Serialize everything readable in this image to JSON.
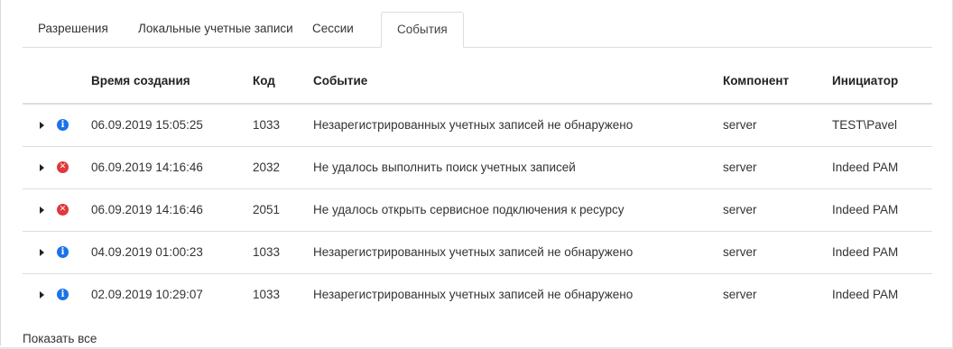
{
  "tabs": [
    {
      "label": "Разрешения",
      "active": false
    },
    {
      "label": "Локальные учетные записи",
      "active": false
    },
    {
      "label": "Сессии",
      "active": false
    },
    {
      "label": "События",
      "active": true
    }
  ],
  "table": {
    "headers": {
      "time": "Время создания",
      "code": "Код",
      "event": "Событие",
      "component": "Компонент",
      "initiator": "Инициатор"
    },
    "rows": [
      {
        "status": "info-icon",
        "time": "06.09.2019 15:05:25",
        "code": "1033",
        "event": "Незарегистрированных учетных записей не обнаружено",
        "component": "server",
        "initiator": "TEST\\Pavel"
      },
      {
        "status": "error-icon",
        "time": "06.09.2019 14:16:46",
        "code": "2032",
        "event": "Не удалось выполнить поиск учетных записей",
        "component": "server",
        "initiator": "Indeed PAM"
      },
      {
        "status": "error-icon",
        "time": "06.09.2019 14:16:46",
        "code": "2051",
        "event": "Не удалось открыть сервисное подключения к ресурсу",
        "component": "server",
        "initiator": "Indeed PAM"
      },
      {
        "status": "info-icon",
        "time": "04.09.2019 01:00:23",
        "code": "1033",
        "event": "Незарегистрированных учетных записей не обнаружено",
        "component": "server",
        "initiator": "Indeed PAM"
      },
      {
        "status": "info-icon",
        "time": "02.09.2019 10:29:07",
        "code": "1033",
        "event": "Незарегистрированных учетных записей не обнаружено",
        "component": "server",
        "initiator": "Indeed PAM"
      }
    ]
  },
  "footer": {
    "show_all_label": "Показать все"
  },
  "colors": {
    "info": "#1a73e8",
    "error": "#e0383b",
    "border": "#dddddd"
  }
}
